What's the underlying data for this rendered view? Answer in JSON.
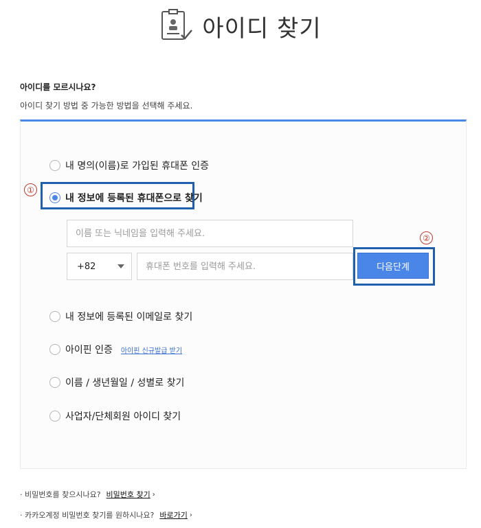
{
  "header": {
    "title": "아이디 찾기",
    "icon": "id-card-check-icon"
  },
  "intro": {
    "question": "아이디를 모르시나요?",
    "description": "아이디 찾기 방법 중 가능한 방법을 선택해 주세요."
  },
  "accent_color": "#4a86e8",
  "highlight_color": "#1f5fae",
  "marker_color": "#c0392b",
  "options": [
    {
      "label": "내 명의(이름)로 가입된 휴대폰 인증",
      "selected": false
    },
    {
      "label": "내 정보에 등록된 휴대폰으로 찾기",
      "selected": true
    },
    {
      "label": "내 정보에 등록된 이메일로 찾기",
      "selected": false
    },
    {
      "label": "아이핀 인증",
      "selected": false,
      "link": "아이핀 신규발급 받기"
    },
    {
      "label": "이름 / 생년월일 / 성별로 찾기",
      "selected": false
    },
    {
      "label": "사업자/단체회원 아이디 찾기",
      "selected": false
    }
  ],
  "form": {
    "name_placeholder": "이름 또는 닉네임을 입력해 주세요.",
    "country_code": "+82",
    "phone_placeholder": "휴대폰 번호를 입력해 주세요.",
    "next_button": "다음단계"
  },
  "markers": {
    "one": "①",
    "two": "②"
  },
  "footer": {
    "pw_question": "비밀번호를 찾으시나요?",
    "pw_link": "비밀번호 찾기",
    "kakao_question": "카카오계정 비밀번호 찾기를 원하시나요?",
    "kakao_link": "바로가기",
    "arrow": "›",
    "bullet": "·"
  }
}
